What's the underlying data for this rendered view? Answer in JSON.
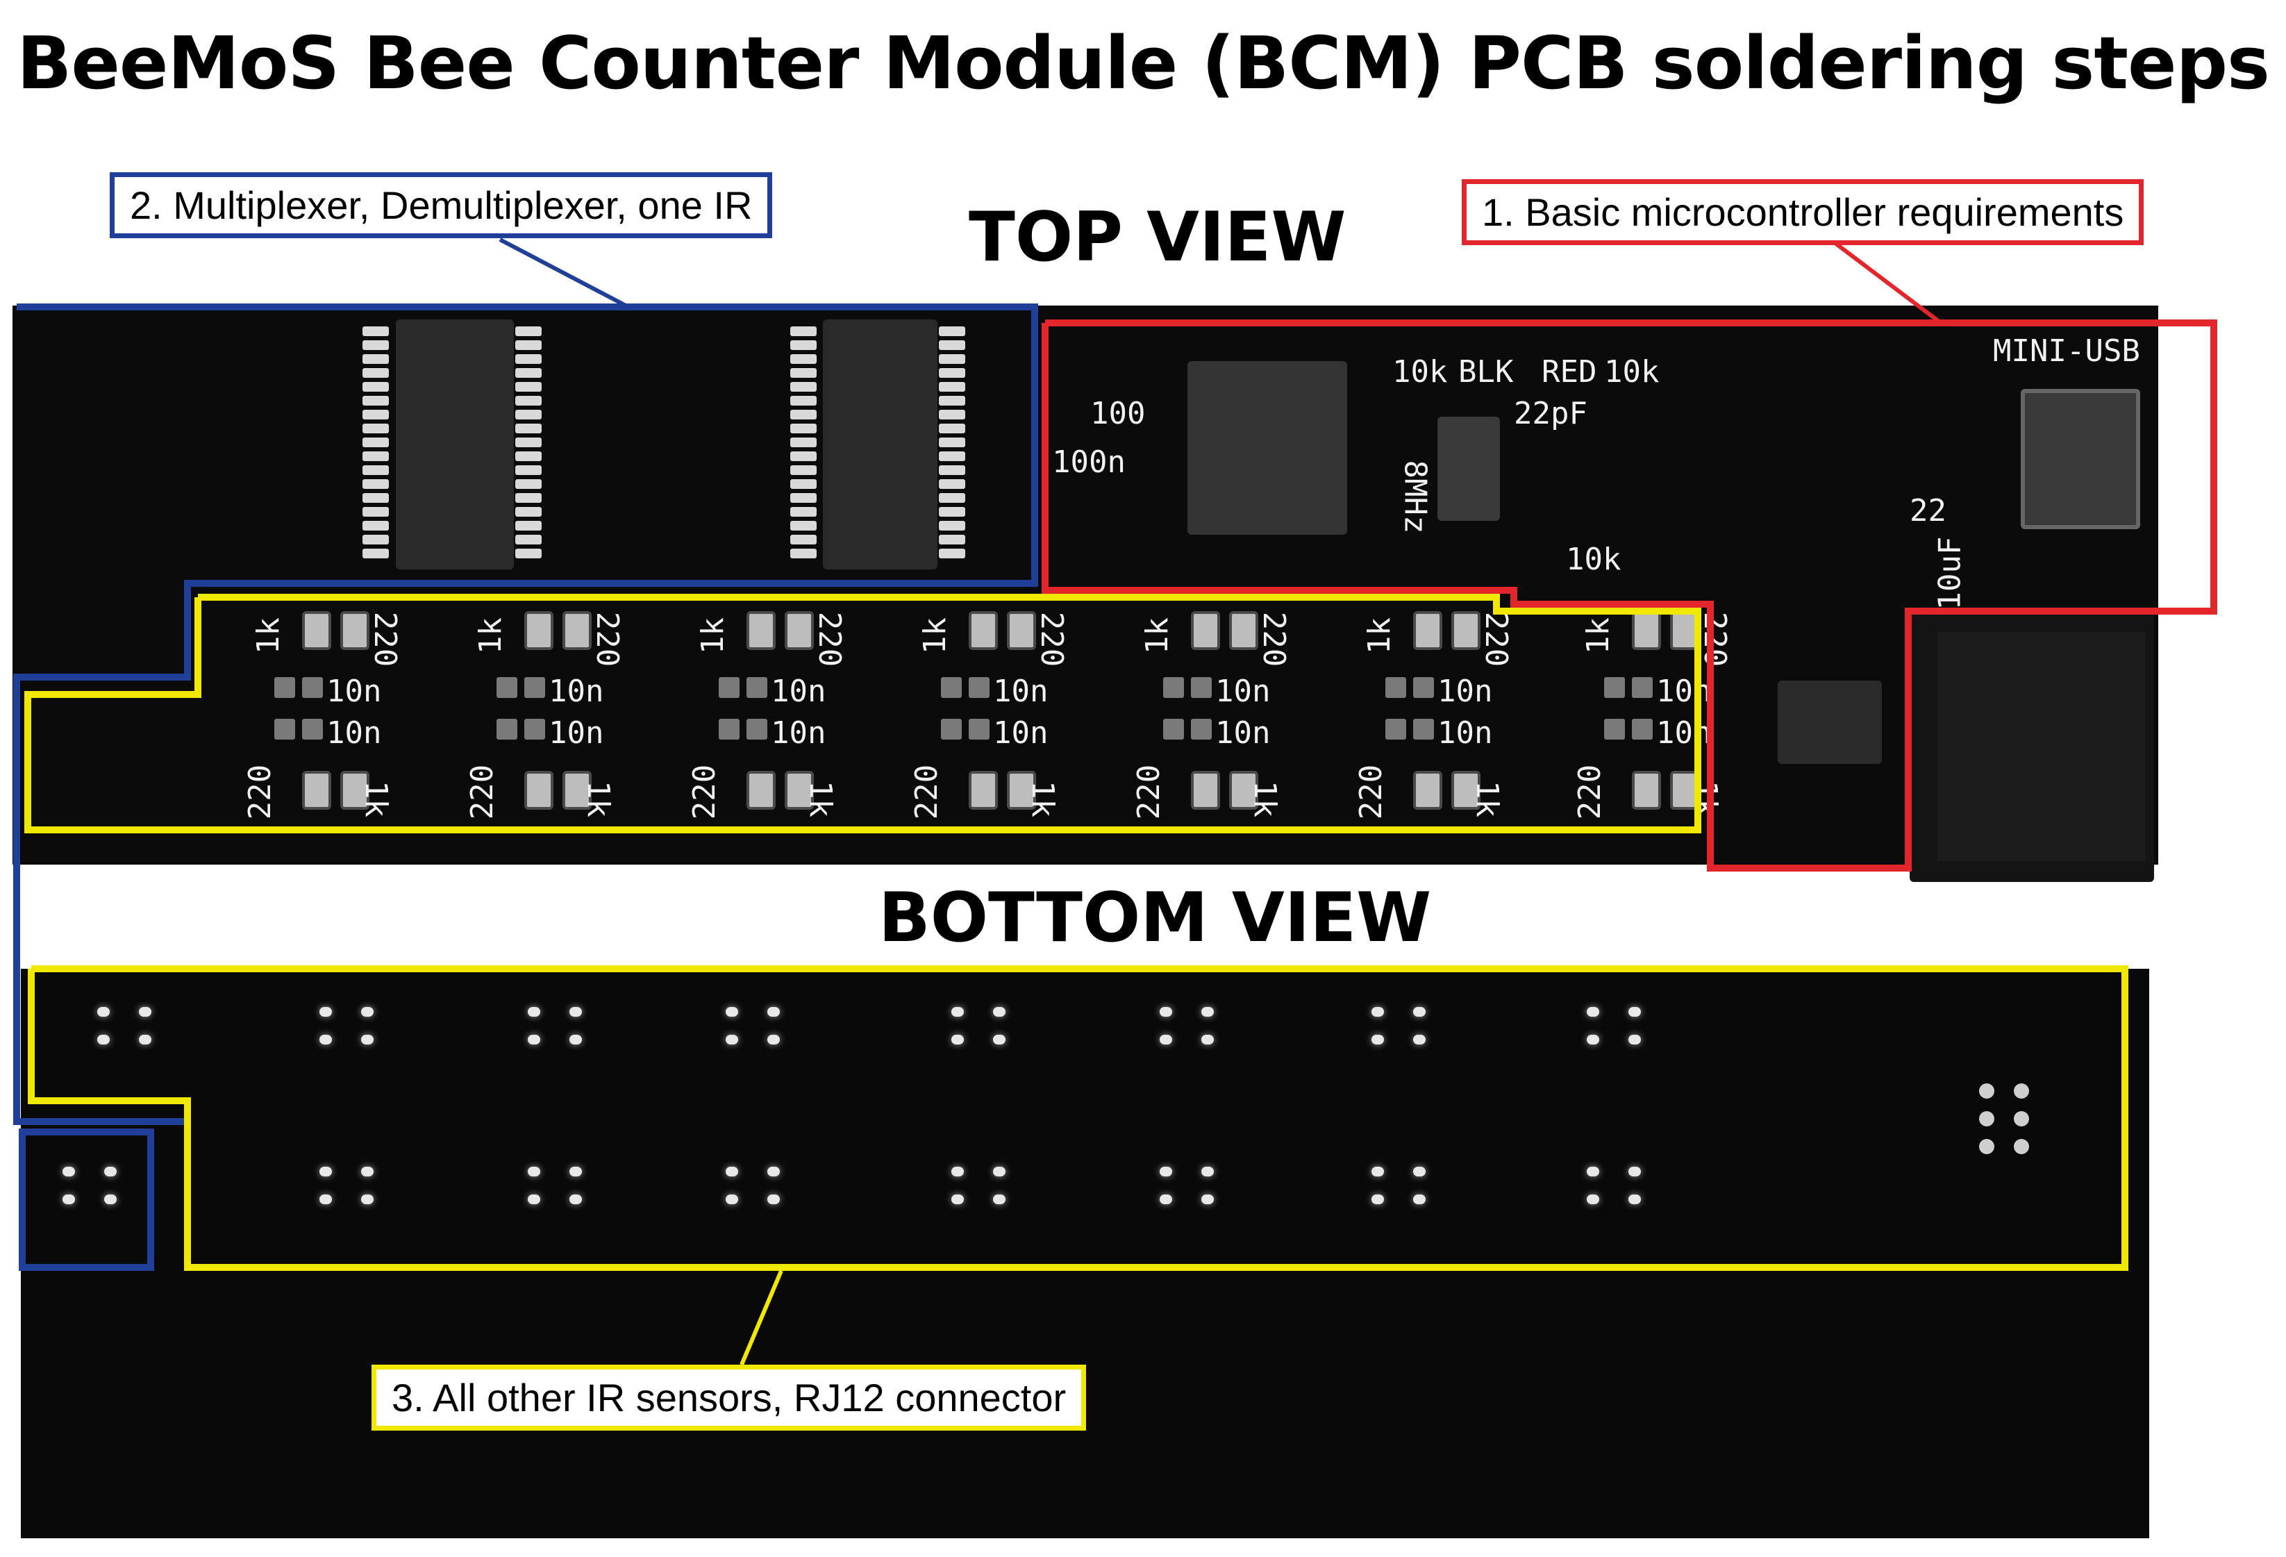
{
  "title": "BeeMoS Bee Counter Module (BCM) PCB soldering steps",
  "views": {
    "top": "TOP VIEW",
    "bottom": "BOTTOM VIEW"
  },
  "steps": [
    {
      "label": "1. Basic microcontroller requirements",
      "color": "#e3262b"
    },
    {
      "label": "2. Multiplexer, Demultiplexer, one IR",
      "color": "#1f3f99"
    },
    {
      "label": "3. All other IR sensors, RJ12 connector",
      "color": "#f1e800"
    }
  ],
  "silkscreen": {
    "usb": "MINI-USB",
    "r10k_a": "10k",
    "blk": "BLK",
    "red": "RED",
    "r10k_b": "10k",
    "c22pf": "22pF",
    "c100": "100",
    "c100n": "100n",
    "xtal": "8MHz",
    "r22": "22",
    "r10k_c": "10k",
    "c10uf": "10uF",
    "r1k": "1k",
    "r220": "220",
    "c10n": "10n"
  }
}
